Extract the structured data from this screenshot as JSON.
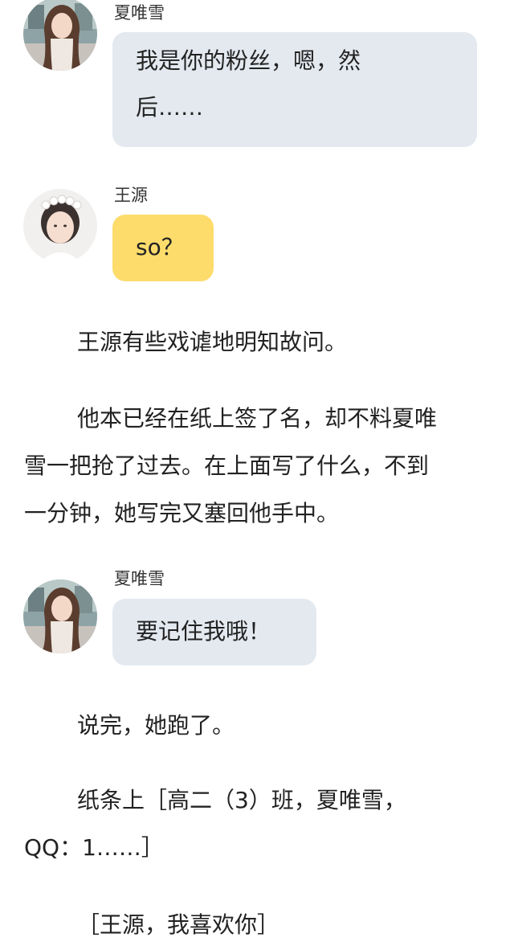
{
  "messages": [
    {
      "sender": "夏唯雪",
      "avatar_icon": "girl-portrait-avatar",
      "text_line1": "我是你的粉丝，嗯，然",
      "text_line2": "后……",
      "bubble_color": "#e4e9f0"
    },
    {
      "sender": "王源",
      "avatar_icon": "boy-flower-crown-avatar",
      "text": "so？",
      "bubble_color": "#fddc6c"
    },
    {
      "sender": "夏唯雪",
      "avatar_icon": "girl-portrait-avatar",
      "text": "要记住我哦！",
      "bubble_color": "#e4e9f0"
    }
  ],
  "narration": [
    "王源有些戏谑地明知故问。",
    "他本已经在纸上签了名，却不料夏唯",
    "雪一把抢了过去。在上面写了什么，不到",
    "一分钟，她写完又塞回他手中。",
    "说完，她跑了。",
    "纸条上［高二（3）班，夏唯雪，",
    "QQ：1……］",
    "［王源，我喜欢你］"
  ]
}
